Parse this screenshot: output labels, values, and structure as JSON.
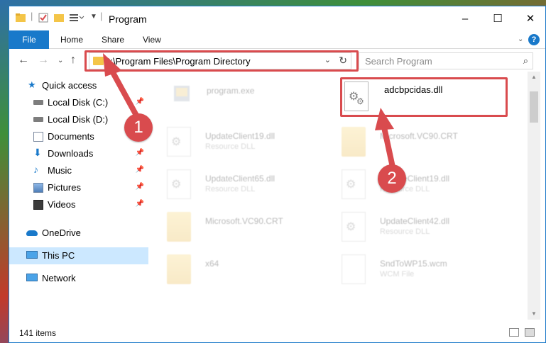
{
  "window": {
    "title": "Program",
    "controls": {
      "minimize": "–",
      "maximize": "☐",
      "close": "✕"
    }
  },
  "ribbon": {
    "tabs": [
      "File",
      "Home",
      "Share",
      "View"
    ]
  },
  "navigation": {
    "address": "C:\\Program Files\\Program Directory",
    "search_placeholder": "Search Program"
  },
  "sidebar": {
    "items": [
      {
        "label": "Quick access",
        "icon": "star-icon",
        "pinned": false
      },
      {
        "label": "Local Disk (C:)",
        "icon": "drive-icon",
        "pinned": true
      },
      {
        "label": "Local Disk (D:)",
        "icon": "drive-icon",
        "pinned": false
      },
      {
        "label": "Documents",
        "icon": "documents-icon",
        "pinned": false
      },
      {
        "label": "Downloads",
        "icon": "downloads-icon",
        "pinned": true
      },
      {
        "label": "Music",
        "icon": "music-icon",
        "pinned": true
      },
      {
        "label": "Pictures",
        "icon": "pictures-icon",
        "pinned": true
      },
      {
        "label": "Videos",
        "icon": "videos-icon",
        "pinned": true
      },
      {
        "label": "OneDrive",
        "icon": "onedrive-icon",
        "pinned": false
      },
      {
        "label": "This PC",
        "icon": "computer-icon",
        "pinned": false,
        "selected": true
      },
      {
        "label": "Network",
        "icon": "network-icon",
        "pinned": false
      }
    ]
  },
  "files": [
    {
      "name": "program.exe",
      "desc": "",
      "kind": "exe"
    },
    {
      "name": "adcbpcidas.dll",
      "desc": "",
      "kind": "dll",
      "highlighted": true
    },
    {
      "name": "UpdateClient19.dll",
      "desc": "Resource DLL",
      "kind": "dll"
    },
    {
      "name": "Microsoft.VC90.CRT",
      "desc": "",
      "kind": "folder"
    },
    {
      "name": "UpdateClient65.dll",
      "desc": "Resource DLL",
      "kind": "dll"
    },
    {
      "name": "UpdateClient19.dll",
      "desc": "Resource DLL",
      "kind": "dll"
    },
    {
      "name": "Microsoft.VC90.CRT",
      "desc": "",
      "kind": "folder"
    },
    {
      "name": "UpdateClient42.dll",
      "desc": "Resource DLL",
      "kind": "dll"
    },
    {
      "name": "x64",
      "desc": "",
      "kind": "folder"
    },
    {
      "name": "SndToWP15.wcm",
      "desc": "WCM File",
      "kind": "doc"
    }
  ],
  "status": {
    "item_count": "141 items"
  },
  "annotations": {
    "step1": "1",
    "step2": "2"
  },
  "colors": {
    "accent": "#1979ca",
    "highlight": "#d94b4e",
    "selected": "#cce8ff"
  }
}
